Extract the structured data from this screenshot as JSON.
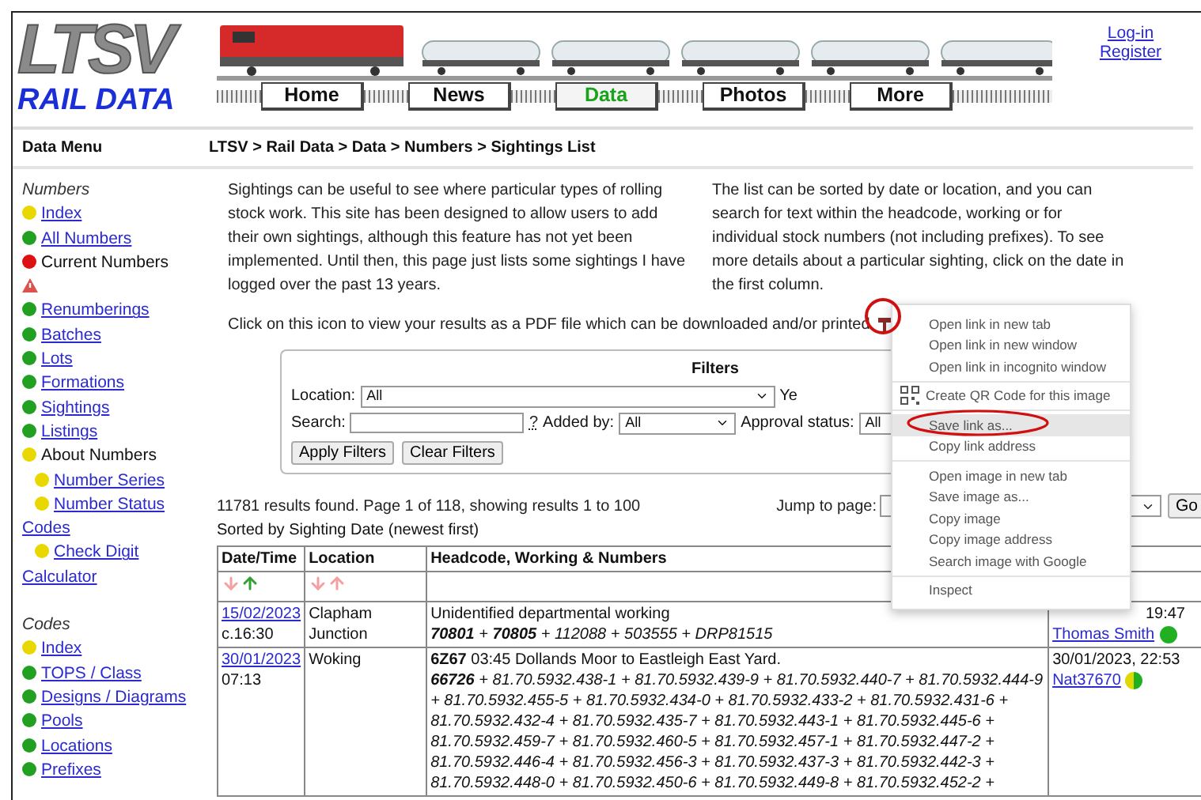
{
  "logo": {
    "letters": "LTSV",
    "subtitle": "RAIL DATA"
  },
  "nav": [
    {
      "label": "Home",
      "selected": false
    },
    {
      "label": "News",
      "selected": false
    },
    {
      "label": "Data",
      "selected": true
    },
    {
      "label": "Photos",
      "selected": false
    },
    {
      "label": "More",
      "selected": false
    }
  ],
  "account_links": [
    "Log-in",
    "Register"
  ],
  "sidebar": {
    "title": "Data Menu",
    "sections": [
      {
        "heading": "Numbers",
        "items": [
          {
            "kind": "link",
            "label": "Index",
            "color": "#e8d800"
          },
          {
            "kind": "link",
            "label": "All Numbers",
            "color": "#22a022"
          },
          {
            "kind": "text",
            "label": "Current Numbers",
            "color": "#dd1111"
          },
          {
            "kind": "warning"
          },
          {
            "kind": "link",
            "label": "Renumberings",
            "color": "#22a022"
          },
          {
            "kind": "link",
            "label": "Batches",
            "color": "#22a022"
          },
          {
            "kind": "link",
            "label": "Lots",
            "color": "#22a022"
          },
          {
            "kind": "link",
            "label": "Formations",
            "color": "#22a022"
          },
          {
            "kind": "link",
            "label": "Sightings",
            "color": "#22a022"
          },
          {
            "kind": "link",
            "label": "Listings",
            "color": "#22a022"
          },
          {
            "kind": "text",
            "label": "About Numbers",
            "color": "#e8d800",
            "children": [
              {
                "kind": "link",
                "label": "Number Series",
                "color": "#e8d800"
              },
              {
                "kind": "link",
                "label": "Number Status Codes",
                "color": "#e8d800"
              },
              {
                "kind": "link",
                "label": "Check Digit Calculator",
                "color": "#e8d800"
              }
            ]
          }
        ]
      },
      {
        "heading": "Codes",
        "items": [
          {
            "kind": "link",
            "label": "Index",
            "color": "#e8d800"
          },
          {
            "kind": "link",
            "label": "TOPS / Class",
            "color": "#22a022"
          },
          {
            "kind": "link",
            "label": "Designs / Diagrams",
            "color": "#22a022"
          },
          {
            "kind": "link",
            "label": "Pools",
            "color": "#22a022"
          },
          {
            "kind": "link",
            "label": "Locations",
            "color": "#22a022"
          },
          {
            "kind": "link",
            "label": "Prefixes",
            "color": "#22a022"
          }
        ]
      }
    ]
  },
  "breadcrumb": "LTSV > Rail Data > Data > Numbers > Sightings List",
  "intro": [
    "Sightings can be useful to see where particular types of rolling stock work. This site has been designed to allow users to add their own sightings, although this feature has not yet been implemented. Until then, this page just lists some sightings I have logged over the past 13 years.",
    "The list can be sorted by date or location, and you can search for text within the headcode, working or for individual stock numbers (not including prefixes). To see more details about a particular sighting, click on the date in the first column."
  ],
  "pdf_note": "Click on this icon to view your results as a PDF file which can be downloaded and/or printed",
  "filters": {
    "title": "Filters",
    "location_label": "Location:",
    "location_value": "All",
    "year_label": "Ye",
    "search_label": "Search:",
    "help": "?",
    "added_by_label": "Added by:",
    "added_by_value": "All",
    "approval_label": "Approval status:",
    "approval_value": "All",
    "buttons": [
      "Apply Filters",
      "Clear Filters"
    ]
  },
  "results": {
    "summary": "11781 results found. Page 1 of 118, showing results 1 to 100",
    "sorted_by": "Sorted by Sighting Date (newest first)",
    "jump_label": "Jump to page:",
    "go": "Go"
  },
  "table": {
    "columns": [
      {
        "label": "Date/Time",
        "sort_up_active": true
      },
      {
        "label": "Location",
        "sort_up_active": false
      },
      {
        "label": "Headcode, Working & Numbers"
      }
    ],
    "rows": [
      {
        "date": "15/02/2023",
        "time": "c.16:30",
        "location": "Clapham Junction",
        "working": "Unidentified departmental working",
        "numbers": "**70801** + **70805** + 112088 + 503555 + DRP81515",
        "added": "19:47",
        "user": {
          "name": "Thomas Smith",
          "kind": "full",
          "color": "#22b022"
        }
      },
      {
        "date": "30/01/2023",
        "time": "07:13",
        "location": "Woking",
        "working": "**6Z67** 03:45 Dollands Moor to Eastleigh East Yard.",
        "numbers": "**66726** + 81.70.5932.438-1 + 81.70.5932.439-9 + 81.70.5932.440-7 + 81.70.5932.444-9 + 81.70.5932.455-5 + 81.70.5932.434-0 + 81.70.5932.433-2 + 81.70.5932.431-6 + 81.70.5932.432-4 + 81.70.5932.435-7 + 81.70.5932.443-1 + 81.70.5932.445-6 + 81.70.5932.459-7 + 81.70.5932.460-5 + 81.70.5932.457-1 + 81.70.5932.447-2 + 81.70.5932.446-4 + 81.70.5932.456-3 + 81.70.5932.437-3 + 81.70.5932.442-3 + 81.70.5932.448-0 + 81.70.5932.450-6 + 81.70.5932.449-8 + 81.70.5932.452-2 +",
        "added": "30/01/2023, 22:53",
        "user": {
          "name": "Nat37670",
          "kind": "half",
          "color": "#e0d800"
        }
      }
    ]
  },
  "context_menu": {
    "groups": [
      [
        {
          "label": "Open link in new tab",
          "selected": false
        },
        {
          "label": "Open link in new window",
          "selected": false
        },
        {
          "label": "Open link in incognito window",
          "selected": false
        }
      ],
      [
        {
          "label": "Create QR Code for this image",
          "selected": false,
          "kind": "qr"
        }
      ],
      [
        {
          "label": "Save link as...",
          "selected": true
        },
        {
          "label": "Copy link address",
          "selected": false
        }
      ],
      [
        {
          "label": "Open image in new tab",
          "selected": false
        },
        {
          "label": "Save image as...",
          "selected": false
        },
        {
          "label": "Copy image",
          "selected": false
        },
        {
          "label": "Copy image address",
          "selected": false
        },
        {
          "label": "Search image with Google",
          "selected": false
        }
      ],
      [
        {
          "label": "Inspect",
          "selected": false
        }
      ]
    ]
  }
}
